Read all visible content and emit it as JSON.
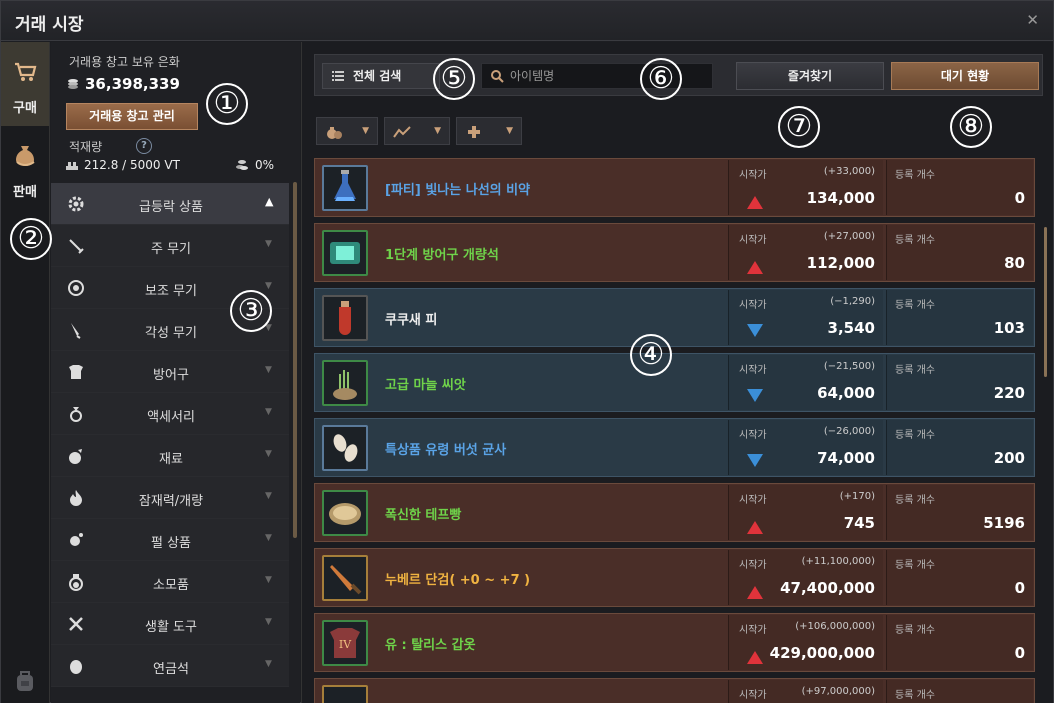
{
  "window": {
    "title": "거래 시장",
    "close_icon": "close-icon"
  },
  "left_tabs": [
    {
      "label": "구매"
    },
    {
      "label": "판매"
    }
  ],
  "wallet": {
    "label": "거래용 창고 보유 은화",
    "silver": "36,398,339",
    "manage_button": "거래용 창고 관리",
    "weight_label": "적재량",
    "help": "?",
    "weight_value": "212.8 / 5000 VT",
    "percent": "0%"
  },
  "categories": [
    {
      "label": "급등락 상품",
      "icon": "gear-icon",
      "active": true
    },
    {
      "label": "주 무기",
      "icon": "sword-icon"
    },
    {
      "label": "보조 무기",
      "icon": "shield-icon"
    },
    {
      "label": "각성 무기",
      "icon": "blade-icon"
    },
    {
      "label": "방어구",
      "icon": "armor-icon"
    },
    {
      "label": "액세서리",
      "icon": "ring-icon"
    },
    {
      "label": "재료",
      "icon": "material-icon"
    },
    {
      "label": "잠재력/개량",
      "icon": "flame-icon"
    },
    {
      "label": "펄 상품",
      "icon": "pearl-icon"
    },
    {
      "label": "소모품",
      "icon": "potion-icon"
    },
    {
      "label": "생활 도구",
      "icon": "tools-icon"
    },
    {
      "label": "연금석",
      "icon": "stone-icon"
    }
  ],
  "search": {
    "category": "전체 검색",
    "placeholder": "아이템명",
    "favorites_button": "즐겨찾기",
    "waitlist_button": "대기 현황"
  },
  "columns": {
    "price_label": "시작가",
    "count_label": "등록 개수"
  },
  "items": [
    {
      "name": "[파티] 빛나는 나선의 비약",
      "name_color": "blue",
      "diff": "(+33,000)",
      "price": "134,000",
      "trend": "up",
      "count": "0",
      "theme": "red"
    },
    {
      "name": "1단계 방어구 개량석",
      "name_color": "green",
      "diff": "(+27,000)",
      "price": "112,000",
      "trend": "up",
      "count": "80",
      "theme": "red"
    },
    {
      "name": "쿠쿠새 피",
      "name_color": "white",
      "diff": "(−1,290)",
      "price": "3,540",
      "trend": "down",
      "count": "103",
      "theme": "blue"
    },
    {
      "name": "고급 마늘 씨앗",
      "name_color": "green",
      "diff": "(−21,500)",
      "price": "64,000",
      "trend": "down",
      "count": "220",
      "theme": "blue"
    },
    {
      "name": "특상품 유령 버섯 균사",
      "name_color": "blue",
      "diff": "(−26,000)",
      "price": "74,000",
      "trend": "down",
      "count": "200",
      "theme": "blue"
    },
    {
      "name": "폭신한 테프빵",
      "name_color": "green",
      "diff": "(+170)",
      "price": "745",
      "trend": "up",
      "count": "5196",
      "theme": "red"
    },
    {
      "name": "누베르 단검( +0 ~ +7 )",
      "name_color": "yellow",
      "diff": "(+11,100,000)",
      "price": "47,400,000",
      "trend": "up",
      "count": "0",
      "theme": "red"
    },
    {
      "name": "유 : 탈리스 갑옷",
      "name_color": "green",
      "diff": "(+106,000,000)",
      "price": "429,000,000",
      "trend": "up",
      "count": "0",
      "theme": "red"
    },
    {
      "name": "",
      "name_color": "white",
      "diff": "(+97,000,000)",
      "price": "",
      "trend": "up",
      "count": "",
      "theme": "red"
    }
  ],
  "badges": [
    "①",
    "②",
    "③",
    "④",
    "⑤",
    "⑥",
    "⑦",
    "⑧"
  ]
}
